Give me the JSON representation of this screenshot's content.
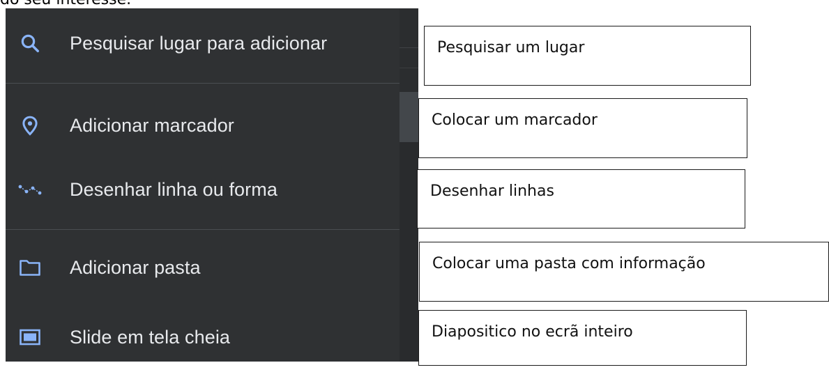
{
  "top_text": "do seu interesse.",
  "menu": {
    "items": [
      {
        "label": "Pesquisar lugar para adicionar",
        "icon": "search-icon"
      },
      {
        "label": "Adicionar marcador",
        "icon": "location-pin-icon"
      },
      {
        "label": "Desenhar linha ou forma",
        "icon": "draw-line-icon"
      },
      {
        "label": "Adicionar pasta",
        "icon": "folder-icon"
      },
      {
        "label": "Slide em tela cheia",
        "icon": "slideshow-icon"
      }
    ]
  },
  "callouts": [
    "Pesquisar um lugar",
    "Colocar um marcador",
    "Desenhar linhas",
    "Colocar uma pasta com informação",
    "Diapositico no ecrã inteiro"
  ],
  "colors": {
    "menu_background": "#2f3133",
    "menu_text": "#e8eaed",
    "icon_blue": "#8ab4f8",
    "divider": "#4b4e52"
  }
}
